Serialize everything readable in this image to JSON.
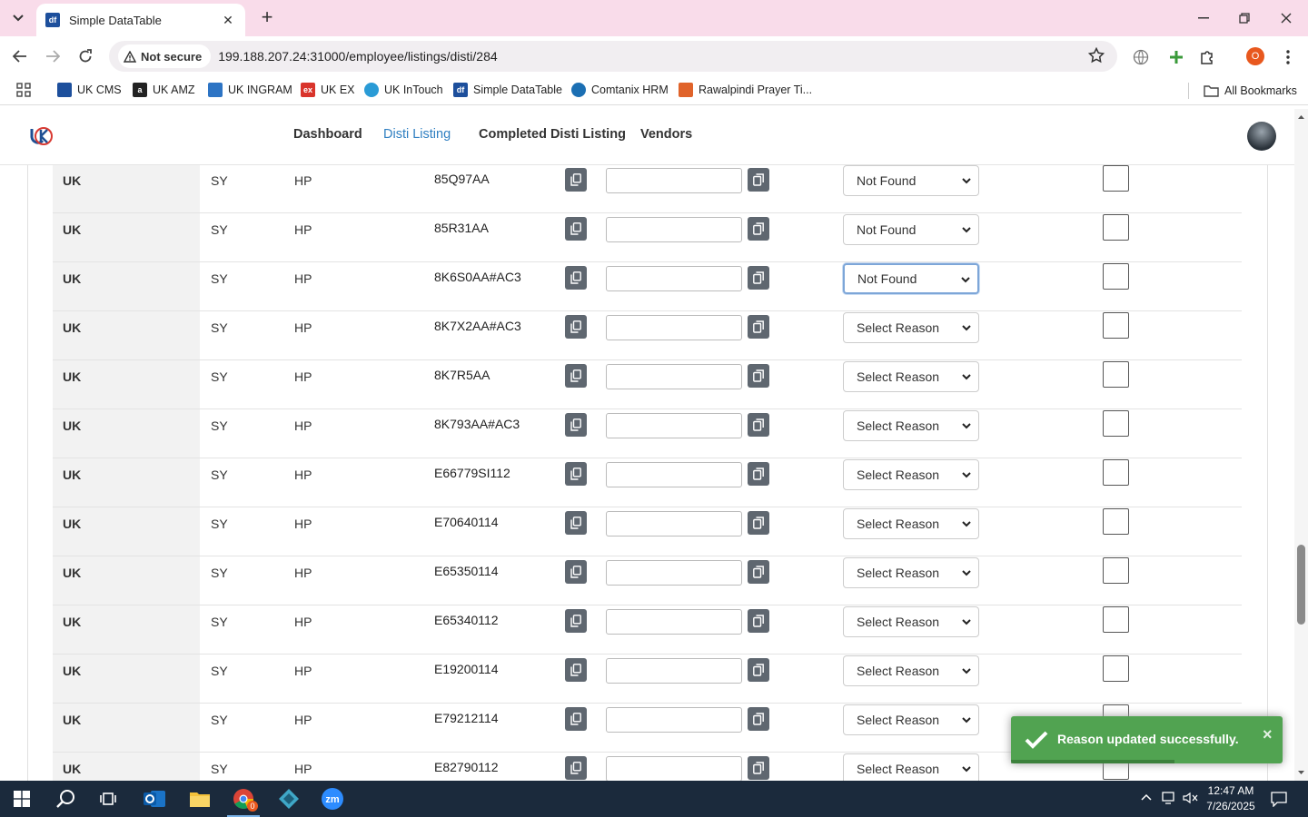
{
  "browser": {
    "tab_title": "Simple DataTable",
    "tab_favicon": "df",
    "security_label": "Not secure",
    "url": "199.188.207.24:31000/employee/listings/disti/284",
    "profile_initial": "O"
  },
  "bookmarks": {
    "items": [
      {
        "label": "UK CMS",
        "color": "#1d4f9c",
        "glyph": ""
      },
      {
        "label": "UK AMZ",
        "color": "#222222",
        "glyph": "a"
      },
      {
        "label": "UK INGRAM",
        "color": "#2d74c4",
        "glyph": ""
      },
      {
        "label": "UK EX",
        "color": "#d9342b",
        "glyph": "ex"
      },
      {
        "label": "UK InTouch",
        "color": "#2a9bd6",
        "glyph": ""
      },
      {
        "label": "Simple DataTable",
        "color": "#1d4f9c",
        "glyph": "df"
      },
      {
        "label": "Comtanix HRM",
        "color": "#1b6fb3",
        "glyph": ""
      },
      {
        "label": "Rawalpindi Prayer Ti...",
        "color": "#e0632a",
        "glyph": ""
      }
    ],
    "all_label": "All Bookmarks"
  },
  "nav": {
    "dashboard": "Dashboard",
    "disti_listing": "Disti Listing",
    "completed": "Completed Disti Listing",
    "vendors": "Vendors"
  },
  "rows": [
    {
      "country": "UK",
      "code": "SY",
      "brand": "HP",
      "sku": "85Q97AA",
      "reason": "Not Found"
    },
    {
      "country": "UK",
      "code": "SY",
      "brand": "HP",
      "sku": "85R31AA",
      "reason": "Not Found"
    },
    {
      "country": "UK",
      "code": "SY",
      "brand": "HP",
      "sku": "8K6S0AA#AC3",
      "reason": "Not Found"
    },
    {
      "country": "UK",
      "code": "SY",
      "brand": "HP",
      "sku": "8K7X2AA#AC3",
      "reason": "Select Reason"
    },
    {
      "country": "UK",
      "code": "SY",
      "brand": "HP",
      "sku": "8K7R5AA",
      "reason": "Select Reason"
    },
    {
      "country": "UK",
      "code": "SY",
      "brand": "HP",
      "sku": "8K793AA#AC3",
      "reason": "Select Reason"
    },
    {
      "country": "UK",
      "code": "SY",
      "brand": "HP",
      "sku": "E66779SI112",
      "reason": "Select Reason"
    },
    {
      "country": "UK",
      "code": "SY",
      "brand": "HP",
      "sku": "E70640114",
      "reason": "Select Reason"
    },
    {
      "country": "UK",
      "code": "SY",
      "brand": "HP",
      "sku": "E65350114",
      "reason": "Select Reason"
    },
    {
      "country": "UK",
      "code": "SY",
      "brand": "HP",
      "sku": "E65340112",
      "reason": "Select Reason"
    },
    {
      "country": "UK",
      "code": "SY",
      "brand": "HP",
      "sku": "E19200114",
      "reason": "Select Reason"
    },
    {
      "country": "UK",
      "code": "SY",
      "brand": "HP",
      "sku": "E79212114",
      "reason": "Select Reason"
    },
    {
      "country": "UK",
      "code": "SY",
      "brand": "HP",
      "sku": "E82790112",
      "reason": "Select Reason"
    }
  ],
  "toast": {
    "message": "Reason updated successfully.",
    "close": "×",
    "color": "#51a351"
  },
  "taskbar": {
    "time": "12:47 AM",
    "date": "7/26/2025",
    "chrome_badge": "0"
  },
  "colors": {
    "accent": "#2f7fc1",
    "tabstrip": "#f9dcea"
  }
}
